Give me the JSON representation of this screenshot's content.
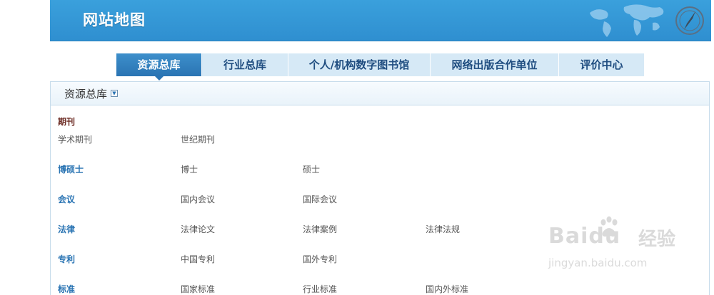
{
  "header": {
    "title": "网站地图"
  },
  "tabs": [
    {
      "label": "资源总库",
      "active": true
    },
    {
      "label": "行业总库",
      "active": false
    },
    {
      "label": "个人/机构数字图书馆",
      "active": false
    },
    {
      "label": "网络出版合作单位",
      "active": false
    },
    {
      "label": "评价中心",
      "active": false
    }
  ],
  "panel": {
    "title": "资源总库",
    "categories": [
      {
        "title": "期刊",
        "items": [
          "学术期刊",
          "世纪期刊"
        ]
      },
      {
        "title": "博硕士",
        "items": [
          "博士",
          "硕士"
        ]
      },
      {
        "title": "会议",
        "items": [
          "国内会议",
          "国际会议"
        ]
      },
      {
        "title": "法律",
        "items": [
          "法律论文",
          "法律案例",
          "法律法规"
        ]
      },
      {
        "title": "专利",
        "items": [
          "中国专利",
          "国外专利"
        ]
      },
      {
        "title": "标准",
        "items": [
          "国家标准",
          "行业标准",
          "国内外标准"
        ]
      }
    ]
  },
  "watermark": {
    "brand": "Baidu",
    "cn": "经验",
    "url": "jingyan.baidu.com"
  },
  "colors": {
    "banner": "#3aa0dc",
    "active_tab": "#2a74b3",
    "tab_bg": "#d6e9f6",
    "category": "#2a74b3"
  }
}
